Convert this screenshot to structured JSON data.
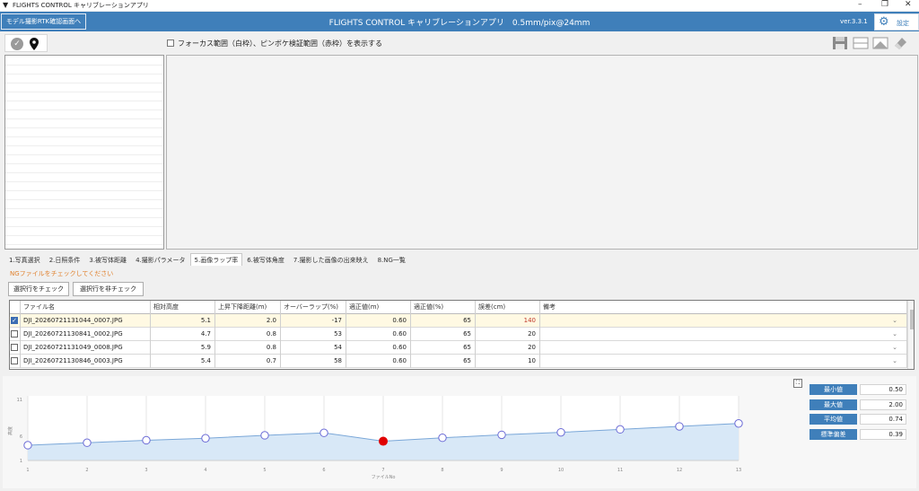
{
  "window": {
    "title": "FLIGHTS CONTROL キャリブレーションアプリ",
    "min": "–",
    "max": "❐",
    "close": "✕"
  },
  "header": {
    "rtk_button": "モデル撮影RTK確認画面へ",
    "title": "FLIGHTS CONTROL キャリブレーションアプリ　0.5mm/pix@24mm",
    "version": "ver.3.3.1",
    "settings_label": "設定"
  },
  "toolbar": {
    "focus_option": "フォーカス範囲（白枠）、ピンボケ検証範囲（赤枠）を表示する",
    "icons": [
      "save-icon",
      "split-horizontal-icon",
      "image-icon",
      "eraser-icon"
    ]
  },
  "tabs": [
    {
      "label": "1.写真選択",
      "active": false
    },
    {
      "label": "2.日照条件",
      "active": false
    },
    {
      "label": "3.被写体距離",
      "active": false
    },
    {
      "label": "4.撮影パラメータ",
      "active": false
    },
    {
      "label": "5.画像ラップ率",
      "active": true
    },
    {
      "label": "6.被写体角度",
      "active": false
    },
    {
      "label": "7.撮影した画像の出来映え",
      "active": false
    },
    {
      "label": "8.NG一覧",
      "active": false
    }
  ],
  "ng_note": "NGファイルをチェックしてください",
  "buttons": {
    "check_selected": "選択行をチェック",
    "uncheck_selected": "選択行を非チェック"
  },
  "table": {
    "headers": [
      "ファイル名",
      "相対高度",
      "上昇下降距離(m)",
      "オーバーラップ(%)",
      "適正値(m)",
      "適正値(%)",
      "誤差(cm)",
      "備考"
    ],
    "rows": [
      {
        "checked": true,
        "cells": [
          "DJI_20260721131044_0007.JPG",
          "5.1",
          "2.0",
          "-17",
          "0.60",
          "65",
          "140",
          ""
        ]
      },
      {
        "checked": false,
        "cells": [
          "DJI_20260721130841_0002.JPG",
          "4.7",
          "0.8",
          "53",
          "0.60",
          "65",
          "20",
          ""
        ]
      },
      {
        "checked": false,
        "cells": [
          "DJI_20260721131049_0008.JPG",
          "5.9",
          "0.8",
          "54",
          "0.60",
          "65",
          "20",
          ""
        ]
      },
      {
        "checked": false,
        "cells": [
          "DJI_20260721130846_0003.JPG",
          "5.4",
          "0.7",
          "58",
          "0.60",
          "65",
          "10",
          ""
        ]
      }
    ],
    "highlight_color": "#c0392b"
  },
  "chart_data": {
    "type": "area",
    "x": [
      1,
      2,
      3,
      4,
      5,
      6,
      7,
      8,
      9,
      10,
      11,
      12,
      13
    ],
    "y": [
      4.1,
      4.6,
      5.1,
      5.5,
      6.1,
      6.6,
      4.9,
      5.6,
      6.2,
      6.7,
      7.3,
      7.9,
      8.5
    ],
    "highlight_index": 6,
    "xlabel": "ファイルNo",
    "ylabel": "高度",
    "yticks": [
      "1",
      "6",
      "11"
    ],
    "ylim": [
      1,
      13
    ],
    "xlim": [
      1,
      13
    ],
    "fill_color": "#d8e8f7",
    "line_color": "#7aa7d8",
    "marker_color": "#6b6bd6",
    "highlight_color": "#e00000"
  },
  "stats": [
    {
      "label": "最小値",
      "value": "0.50"
    },
    {
      "label": "最大値",
      "value": "2.00"
    },
    {
      "label": "平均値",
      "value": "0.74"
    },
    {
      "label": "標準偏差",
      "value": "0.39"
    }
  ]
}
